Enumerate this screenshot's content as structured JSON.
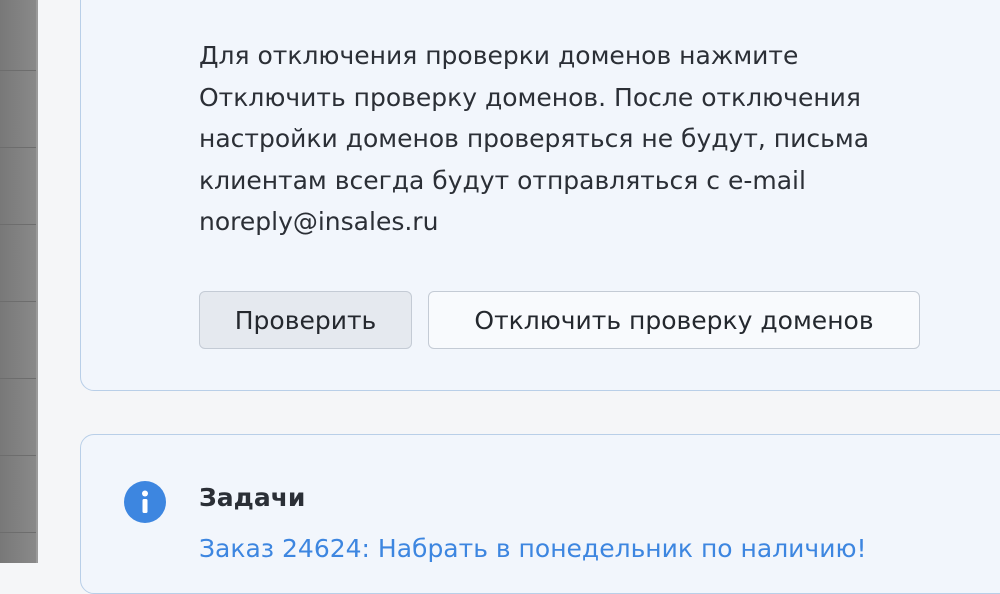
{
  "domain_notice": {
    "description": "Для отключения проверки доменов нажмите\nОтключить проверку доменов. После отключения\nнастройки доменов проверяться не будут, письма\nклиентам всегда будут отправляться с e-mail\nnoreply@insales.ru",
    "check_button_label": "Проверить",
    "disable_button_label": "Отключить проверку доменов"
  },
  "tasks": {
    "icon": "info-icon",
    "title": "Задачи",
    "items": [
      {
        "label": "Заказ 24624: Набрать в понедельник по наличию!"
      }
    ]
  },
  "colors": {
    "panel_bg": "#f2f6fc",
    "panel_border": "#b9cfe8",
    "link": "#3d86e0",
    "icon": "#3d86e0",
    "text": "#2b2f36"
  }
}
